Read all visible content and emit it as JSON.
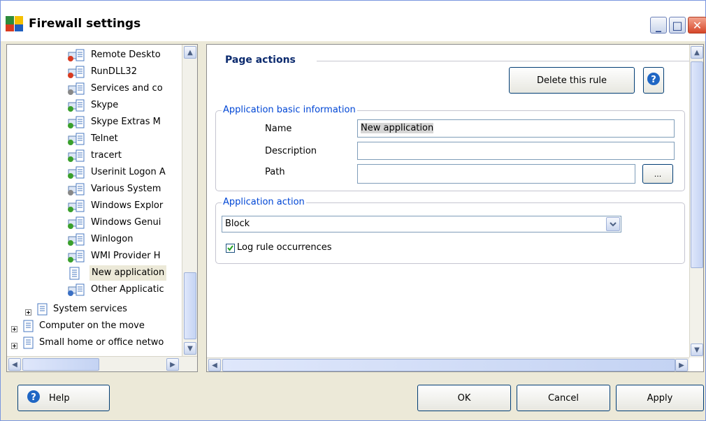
{
  "window": {
    "title": "Firewall settings",
    "icon": "avg-logo-icon",
    "minimize_glyph": "_",
    "maximize_glyph": "□",
    "close_glyph": "✕"
  },
  "tree": {
    "items": [
      {
        "label": "Remote Deskto",
        "icon": "blocked-app-icon",
        "status_color": "#d83a20"
      },
      {
        "label": "RunDLL32",
        "icon": "blocked-app-icon",
        "status_color": "#d83a20"
      },
      {
        "label": "Services and co",
        "icon": "settings-app-icon",
        "status_color": "#888888"
      },
      {
        "label": "Skype",
        "icon": "allowed-app-icon",
        "status_color": "#3aa02c"
      },
      {
        "label": "Skype Extras M",
        "icon": "allowed-app-icon",
        "status_color": "#3aa02c"
      },
      {
        "label": "Telnet",
        "icon": "allowed-app-icon",
        "status_color": "#3aa02c"
      },
      {
        "label": "tracert",
        "icon": "allowed-app-icon",
        "status_color": "#3aa02c"
      },
      {
        "label": "Userinit Logon A",
        "icon": "allowed-app-icon",
        "status_color": "#3aa02c"
      },
      {
        "label": "Various System",
        "icon": "settings-app-icon",
        "status_color": "#888888"
      },
      {
        "label": "Windows Explor",
        "icon": "allowed-app-icon",
        "status_color": "#3aa02c"
      },
      {
        "label": "Windows Genui",
        "icon": "allowed-app-icon",
        "status_color": "#3aa02c"
      },
      {
        "label": "Winlogon",
        "icon": "allowed-app-icon",
        "status_color": "#3aa02c"
      },
      {
        "label": "WMI Provider H",
        "icon": "allowed-app-icon",
        "status_color": "#3aa02c"
      },
      {
        "label": "New application",
        "icon": "document-icon",
        "status_color": "",
        "selected": true
      },
      {
        "label": "Other Applicatic",
        "icon": "unknown-app-icon",
        "status_color": "#3a6fc4"
      }
    ],
    "groups": [
      {
        "label": "System services",
        "expander": "+"
      },
      {
        "label": "Computer on the move",
        "expander": "+"
      },
      {
        "label": "Small home or office netwo",
        "expander": "+"
      }
    ],
    "scroll_left": "<",
    "scroll_right": ">",
    "scroll_up": "^",
    "scroll_down": "v"
  },
  "page": {
    "section_title": "Page actions",
    "delete_button": "Delete this rule",
    "help_icon": "?",
    "basic_info": {
      "legend": "Application basic information",
      "name_label": "Name",
      "name_value": "New application",
      "description_label": "Description",
      "description_value": "",
      "path_label": "Path",
      "path_value": "",
      "browse_label": "..."
    },
    "action": {
      "legend": "Application action",
      "selected": "Block",
      "log_label": "Log rule occurrences",
      "log_checked": true
    }
  },
  "footer": {
    "help": "Help",
    "ok": "OK",
    "cancel": "Cancel",
    "apply": "Apply"
  },
  "colors": {
    "group_legend": "#0046d5",
    "section_title": "#0b2a6e",
    "selection_bg": "#ece9d8"
  }
}
